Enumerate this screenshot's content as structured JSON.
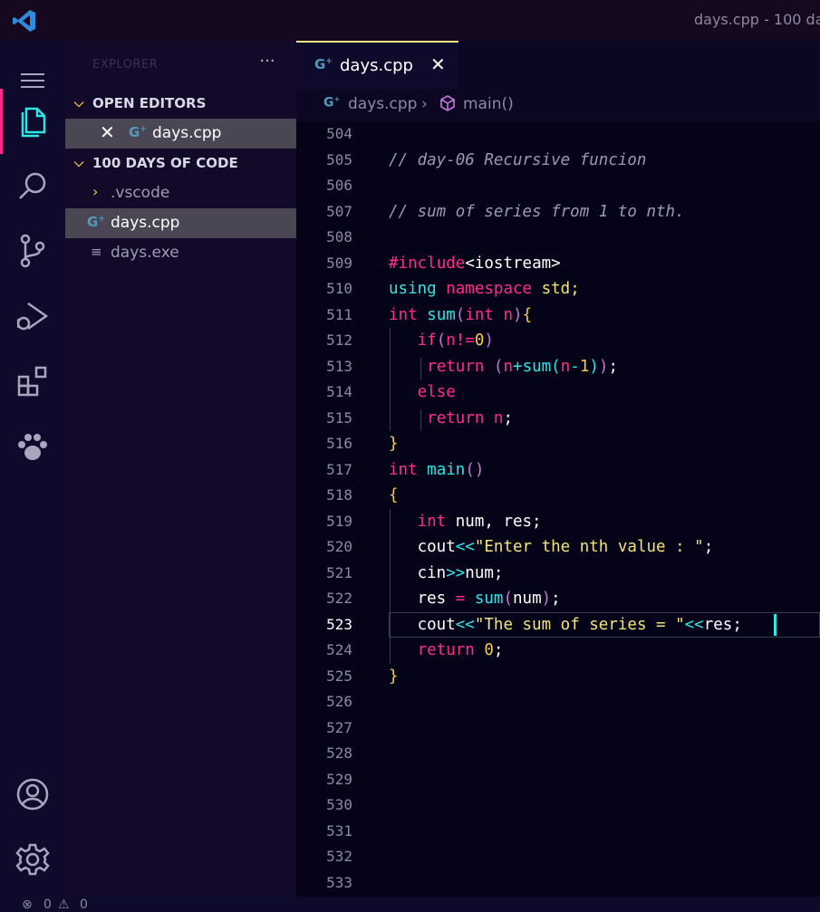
{
  "window": {
    "title": "days.cpp - 100 da"
  },
  "sidebar": {
    "explorer_title": "EXPLORER",
    "more": "···",
    "open_editors_label": "OPEN EDITORS",
    "open_editors": [
      {
        "label": "days.cpp"
      }
    ],
    "folder_label": "100 DAYS OF CODE",
    "items": [
      {
        "label": ".vscode",
        "icon": "chevron-right-icon"
      },
      {
        "label": "days.cpp",
        "icon": "cpp-file-icon"
      },
      {
        "label": "days.exe",
        "icon": "binary-file-icon"
      }
    ]
  },
  "tab": {
    "label": "days.cpp"
  },
  "breadcrumb": {
    "file": "days.cpp",
    "symbol": "main()"
  },
  "editor": {
    "current_line": 523,
    "line_numbers": [
      "504",
      "505",
      "506",
      "507",
      "508",
      "509",
      "510",
      "511",
      "512",
      "513",
      "514",
      "515",
      "516",
      "517",
      "518",
      "519",
      "520",
      "521",
      "522",
      "523",
      "524",
      "525",
      "526",
      "527",
      "528",
      "529",
      "530",
      "531",
      "532",
      "533"
    ],
    "lines": {
      "l505": "// day-06 Recursive funcion",
      "l507": "// sum of series from 1 to nth.",
      "l509_hash": "#",
      "l509_kw": "include",
      "l509_hdr": "<iostream>",
      "l510_kw1": "using",
      "l510_kw2": "namespace",
      "l510_id": "std;",
      "l511_ty": "int",
      "l511_fn": "sum",
      "l511_p1": "(",
      "l511_ty2": "int",
      "l511_id": "n",
      "l511_p2": ")",
      "l511_b": "{",
      "l512_kw": "if",
      "l512_p1": "(",
      "l512_id": "n",
      "l512_op": "!=",
      "l512_num": "0",
      "l512_p2": ")",
      "l513_kw": "return",
      "l513_p1": "(",
      "l513_id": "n",
      "l513_op": "+",
      "l513_fn": "sum",
      "l513_p2": "(",
      "l513_id2": "n",
      "l513_op2": "-",
      "l513_num": "1",
      "l513_p3": ")",
      "l513_p4": ")",
      "l513_end": ";",
      "l514_kw": "else",
      "l515_kw": "return",
      "l515_id": "n",
      "l515_end": ";",
      "l516_b": "}",
      "l517_ty": "int",
      "l517_fn": "main",
      "l517_p": "()",
      "l518_b": "{",
      "l519_ty": "int",
      "l519_id": "num, res;",
      "l520_id": "cout",
      "l520_op": "<<",
      "l520_st": "\"Enter the nth value : \"",
      "l520_end": ";",
      "l521_id": "cin",
      "l521_op": ">>",
      "l521_id2": "num;",
      "l522_id": "res",
      "l522_op": "=",
      "l522_fn": "sum",
      "l522_p1": "(",
      "l522_id2": "num",
      "l522_p2": ")",
      "l522_end": ";",
      "l523_id": "cout",
      "l523_op": "<<",
      "l523_st": "\"The sum of series = \"",
      "l523_op2": "<<",
      "l523_id2": "res;",
      "l524_kw": "return",
      "l524_num": "0",
      "l524_end": ";",
      "l525_b": "}"
    }
  },
  "statusbar": {
    "errors": "0",
    "warnings": "0"
  },
  "colors": {
    "accent": "#ff2e88",
    "cyan": "#2ee6e6",
    "yellow": "#f2e37a",
    "purple": "#c678dd"
  },
  "activity_icons": [
    "explorer-icon",
    "search-icon",
    "source-control-icon",
    "run-debug-icon",
    "extensions-icon",
    "paw-icon",
    "account-icon",
    "gear-icon"
  ]
}
